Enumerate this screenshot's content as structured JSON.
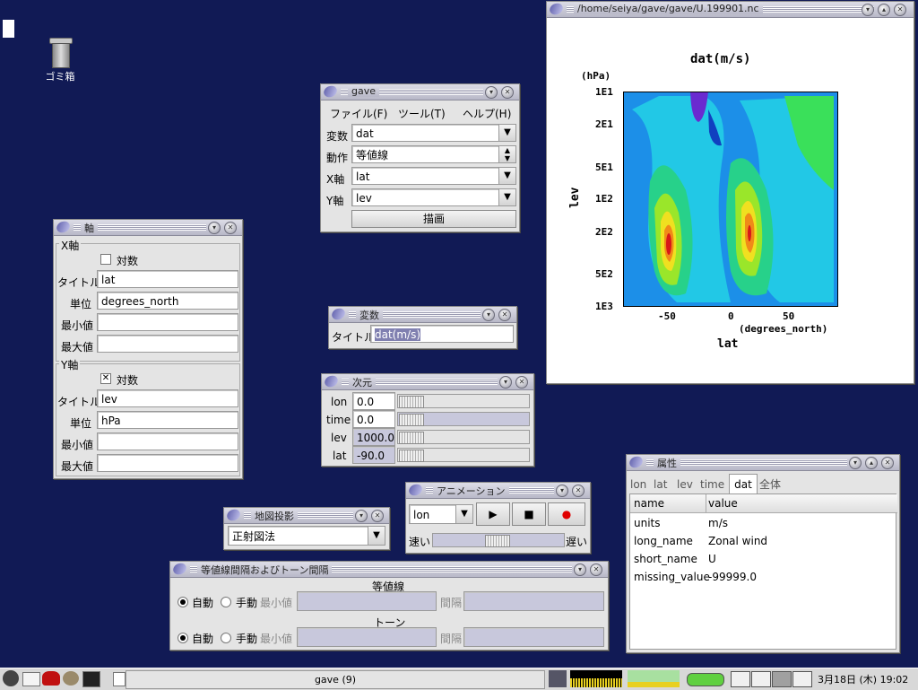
{
  "desktop": {
    "trash_label": "ゴミ箱"
  },
  "plot_window": {
    "title": "/home/seiya/gave/gave/U.199901.nc",
    "plot_title": "dat(m/s)",
    "y_unit": "(hPa)",
    "y_axis_label": "lev",
    "y_ticks": [
      "1E1",
      "2E1",
      "5E1",
      "1E2",
      "2E2",
      "5E2",
      "1E3"
    ],
    "x_ticks": [
      "-50",
      "0",
      "50"
    ],
    "x_unit": "(degrees_north)",
    "x_axis_label": "lat"
  },
  "gave_window": {
    "title": "gave",
    "menu": [
      "ファイル(F)",
      "ツール(T)",
      "ヘルプ(H)"
    ],
    "rows": [
      {
        "label": "変数",
        "value": "dat"
      },
      {
        "label": "動作",
        "value": "等値線"
      },
      {
        "label": "X軸",
        "value": "lat"
      },
      {
        "label": "Y軸",
        "value": "lev"
      }
    ],
    "draw_button": "描画"
  },
  "axis_window": {
    "title": "軸",
    "x_group": "X軸",
    "y_group": "Y軸",
    "log_label": "対数",
    "x_log_checked": "",
    "y_log_checked": "✕",
    "title_label": "タイトル",
    "unit_label": "単位",
    "min_label": "最小値",
    "max_label": "最大値",
    "x_title": "lat",
    "x_unit": "degrees_north",
    "y_title": "lev",
    "y_unit": "hPa"
  },
  "variable_window": {
    "title": "変数",
    "title_label": "タイトル",
    "title_value": "dat(m/s)"
  },
  "dimension_window": {
    "title": "次元",
    "rows": [
      {
        "label": "lon",
        "value": "0.0"
      },
      {
        "label": "time",
        "value": "0.0"
      },
      {
        "label": "lev",
        "value": "1000.0"
      },
      {
        "label": "lat",
        "value": "-90.0"
      }
    ]
  },
  "animation_window": {
    "title": "アニメーション",
    "dimension": "lon",
    "play_icon": "▶",
    "stop_icon": "■",
    "record_icon": "●",
    "fast_label": "速い",
    "slow_label": "遅い"
  },
  "map_window": {
    "title": "地図投影",
    "projection": "正射図法"
  },
  "interval_window": {
    "title": "等値線間隔およびトーン間隔",
    "contour_heading": "等値線",
    "tone_heading": "トーン",
    "auto_label": "自動",
    "manual_label": "手動",
    "min_label": "最小値",
    "interval_label": "間隔"
  },
  "attr_window": {
    "title": "属性",
    "tabs": [
      "lon",
      "lat",
      "lev",
      "time",
      "dat",
      "全体"
    ],
    "active_tab": "dat",
    "headers": [
      "name",
      "value"
    ],
    "rows": [
      {
        "name": "units",
        "value": "m/s"
      },
      {
        "name": "long_name",
        "value": "Zonal wind"
      },
      {
        "name": "short_name",
        "value": "U"
      },
      {
        "name": "missing_value",
        "value": "-99999.0"
      }
    ]
  },
  "taskbar": {
    "task_label": "gave (9)",
    "clock": "3月18日 (木) 19:02"
  },
  "colors": {
    "desktop": "#111a55",
    "accent": "#5a5aa8"
  }
}
